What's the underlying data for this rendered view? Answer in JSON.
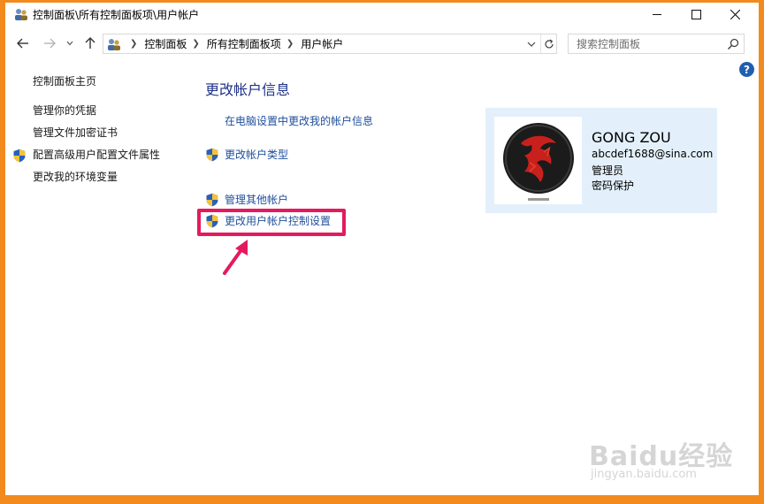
{
  "window": {
    "title": "控制面板\\所有控制面板项\\用户帐户",
    "controls": {
      "minimize": "–",
      "maximize": "☐",
      "close": "✕"
    }
  },
  "address_bar": {
    "crumbs": [
      "控制面板",
      "所有控制面板项",
      "用户帐户"
    ]
  },
  "search": {
    "placeholder": "搜索控制面板"
  },
  "help": {
    "label": "?"
  },
  "left_nav": {
    "home": "控制面板主页",
    "items": [
      {
        "label": "管理你的凭据",
        "shield": false
      },
      {
        "label": "管理文件加密证书",
        "shield": false
      },
      {
        "label": "配置高级用户配置文件属性",
        "shield": true
      },
      {
        "label": "更改我的环境变量",
        "shield": false
      }
    ]
  },
  "main": {
    "title": "更改帐户信息",
    "links": {
      "pc_settings": "在电脑设置中更改我的帐户信息",
      "account_type": "更改帐户类型",
      "manage_other": "管理其他帐户",
      "uac_settings": "更改用户帐户控制设置"
    }
  },
  "account": {
    "name": "GONG ZOU",
    "email": "abcdef1688@sina.com",
    "role": "管理员",
    "status": "密码保护"
  },
  "watermark": {
    "logo": "Baidu经验",
    "url": "jingyan.baidu.com"
  },
  "colors": {
    "frame": "#f28a1e",
    "link": "#1f4e9c",
    "title": "#1e3287",
    "highlight": "#e5195f",
    "card_bg": "#e3f0fb"
  }
}
